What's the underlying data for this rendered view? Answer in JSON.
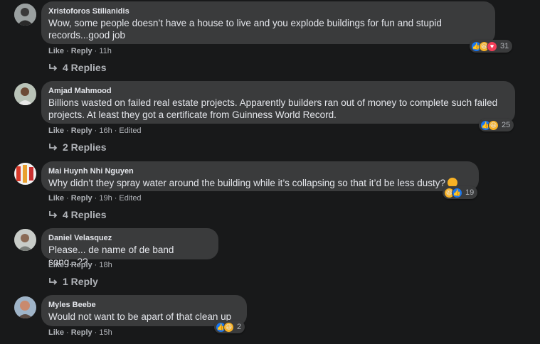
{
  "comments": [
    {
      "author": "Xristoforos Stilianidis",
      "text": "Wow, some people doesn’t have a house to live and you explode buildings for fun and stupid records...good job",
      "like": "Like",
      "reply": "Reply",
      "time": "11h",
      "edited": "",
      "replies": "4 Replies",
      "reaction_count": "31",
      "reaction_icons": [
        "like-icon",
        "haha-icon",
        "love-icon"
      ]
    },
    {
      "author": "Amjad Mahmood",
      "text": "Billions wasted on failed real estate projects. Apparently builders ran out of money to complete such failed projects. At least they got a certificate from Guinness World Record.",
      "like": "Like",
      "reply": "Reply",
      "time": "16h",
      "edited": "Edited",
      "replies": "2 Replies",
      "reaction_count": "25",
      "reaction_icons": [
        "like-icon",
        "haha-icon"
      ]
    },
    {
      "author": "Mai Huynh Nhi Nguyen",
      "text": "Why didn’t they spray water around the building while it’s collapsing so that it’d be less dusty?",
      "like": "Like",
      "reply": "Reply",
      "time": "19h",
      "edited": "Edited",
      "replies": "4 Replies",
      "reaction_count": "19",
      "reaction_icons": [
        "haha-icon",
        "like-icon"
      ]
    },
    {
      "author": "Daniel Velasquez",
      "text": "Please... de name of de band song...??",
      "like": "Like",
      "reply": "Reply",
      "time": "18h",
      "edited": "",
      "replies": "1 Reply",
      "reaction_count": "",
      "reaction_icons": []
    },
    {
      "author": "Myles Beebe",
      "text": "Would not want to be apart of that clean up",
      "like": "Like",
      "reply": "Reply",
      "time": "15h",
      "edited": "",
      "replies": "",
      "reaction_count": "2",
      "reaction_icons": [
        "like-icon",
        "haha-icon"
      ]
    }
  ],
  "colors": {
    "background": "#18191a",
    "bubble": "#3a3b3c",
    "text": "#e4e6eb",
    "secondary": "#b0b3b8",
    "like_blue": "#1877f2",
    "haha_yellow": "#f7b125",
    "love_red": "#f33e58"
  }
}
